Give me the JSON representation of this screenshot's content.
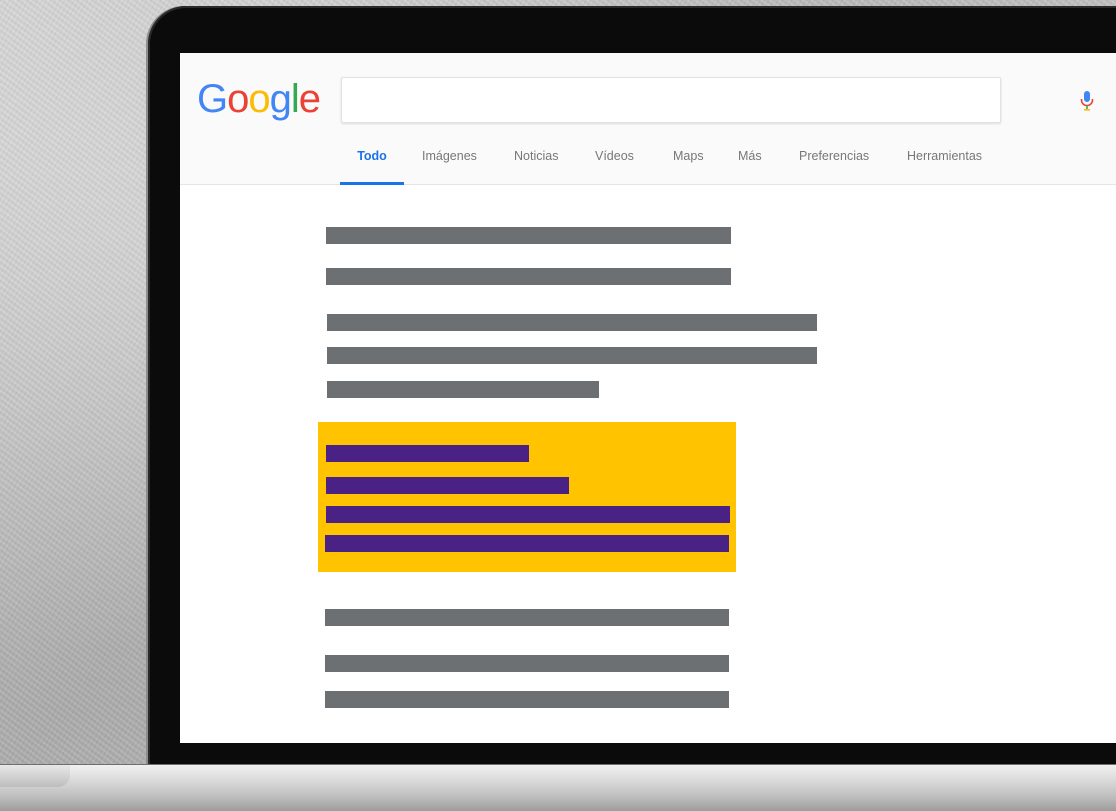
{
  "search": {
    "logo_text": "Google",
    "query": "",
    "placeholder": ""
  },
  "logo_letters": [
    {
      "ch": "G",
      "color": "#4285F4"
    },
    {
      "ch": "o",
      "color": "#EA4335"
    },
    {
      "ch": "o",
      "color": "#FBBC05"
    },
    {
      "ch": "g",
      "color": "#4285F4"
    },
    {
      "ch": "l",
      "color": "#34A853"
    },
    {
      "ch": "e",
      "color": "#EA4335"
    }
  ],
  "tabs": [
    {
      "label": "Todo",
      "active": true
    },
    {
      "label": "Imágenes",
      "active": false
    },
    {
      "label": "Noticias",
      "active": false
    },
    {
      "label": "Vídeos",
      "active": false
    },
    {
      "label": "Maps",
      "active": false
    },
    {
      "label": "Más",
      "active": false
    },
    {
      "label": "Preferencias",
      "active": false
    },
    {
      "label": "Herramientas",
      "active": false
    }
  ],
  "icons": {
    "mic": "mic-icon",
    "search": "search-icon"
  },
  "colors": {
    "accent": "#1a73e8",
    "placeholder_bar": "#6d7073",
    "featured_snippet_bg": "#ffc300",
    "featured_snippet_bar": "#4a2286"
  }
}
